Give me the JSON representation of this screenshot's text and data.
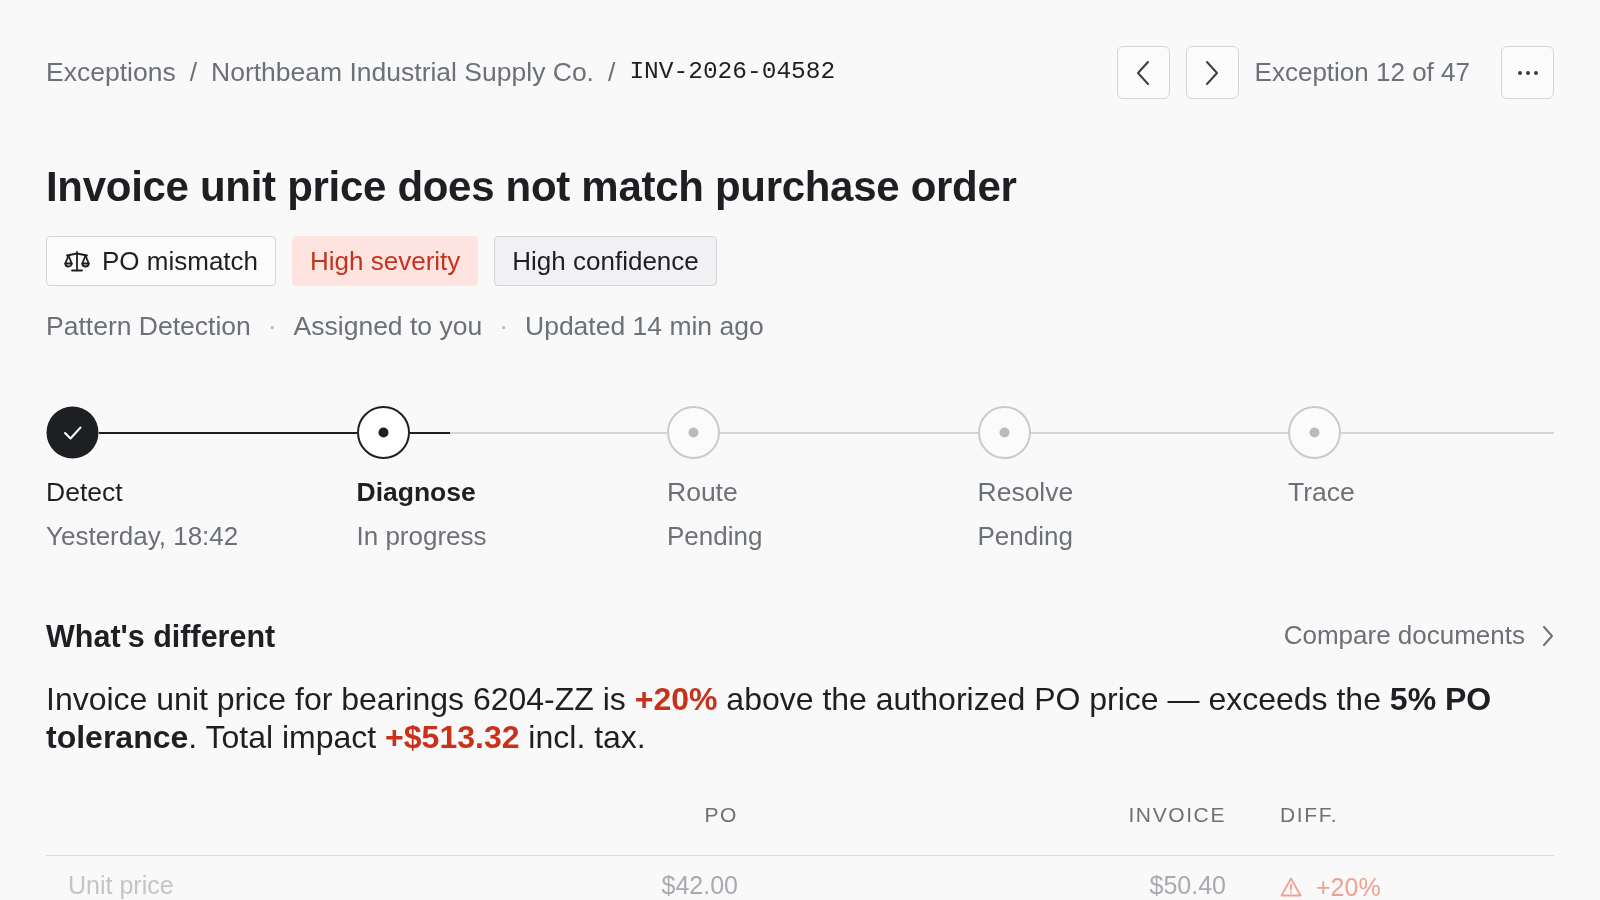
{
  "breadcrumb": [
    {
      "text": "Exceptions",
      "kind": "link"
    },
    {
      "text": "/",
      "kind": "separator"
    },
    {
      "text": "Northbeam Industrial Supply Co.",
      "kind": "link"
    },
    {
      "text": "/",
      "kind": "separator"
    },
    {
      "text": "INV-2026-04582",
      "kind": "current"
    }
  ],
  "pager": {
    "label": "Exception 12 of 47"
  },
  "title": "Invoice unit price does not match purchase order",
  "tags": [
    {
      "text": "PO mismatch",
      "kind": "category"
    },
    {
      "text": "High severity",
      "kind": "severity"
    },
    {
      "text": "High confidence",
      "kind": "confidence"
    }
  ],
  "meta": [
    {
      "text": "Pattern Detection",
      "kind": "item"
    },
    {
      "text": "·",
      "kind": "separator"
    },
    {
      "text": "Assigned to you",
      "kind": "item"
    },
    {
      "text": "·",
      "kind": "separator"
    },
    {
      "text": "Updated 14 min ago",
      "kind": "item"
    }
  ],
  "steps": [
    {
      "label": "Detect",
      "detail": "Yesterday, 18:42",
      "completed": true,
      "selected": false
    },
    {
      "label": "Diagnose",
      "detail": "In progress",
      "completed": false,
      "selected": true
    },
    {
      "label": "Route",
      "detail": "Pending",
      "completed": false,
      "selected": false
    },
    {
      "label": "Resolve",
      "detail": "Pending",
      "completed": false,
      "selected": false
    },
    {
      "label": "Trace",
      "completed": false,
      "selected": false
    }
  ],
  "difference": {
    "heading": "What's different",
    "link": "Compare documents",
    "summary": [
      {
        "text": "Invoice unit price for bearings 6204-ZZ is ",
        "kind": "plain"
      },
      {
        "text": "+20%",
        "kind": "alert"
      },
      {
        "text": " above the authorized PO price — exceeds the ",
        "kind": "plain"
      },
      {
        "text": "5% PO tolerance",
        "kind": "strong"
      },
      {
        "text": ". Total impact ",
        "kind": "plain"
      },
      {
        "text": "+$513.32",
        "kind": "alert"
      },
      {
        "text": " incl. tax.",
        "kind": "plain"
      }
    ]
  },
  "comparison": {
    "columns": [
      "PO",
      "INVOICE",
      "DIFF."
    ],
    "rows": [
      {
        "label": "Unit price",
        "po": "$42.00",
        "invoice": "$50.40",
        "diff": "+20%",
        "flagged": true
      }
    ]
  }
}
